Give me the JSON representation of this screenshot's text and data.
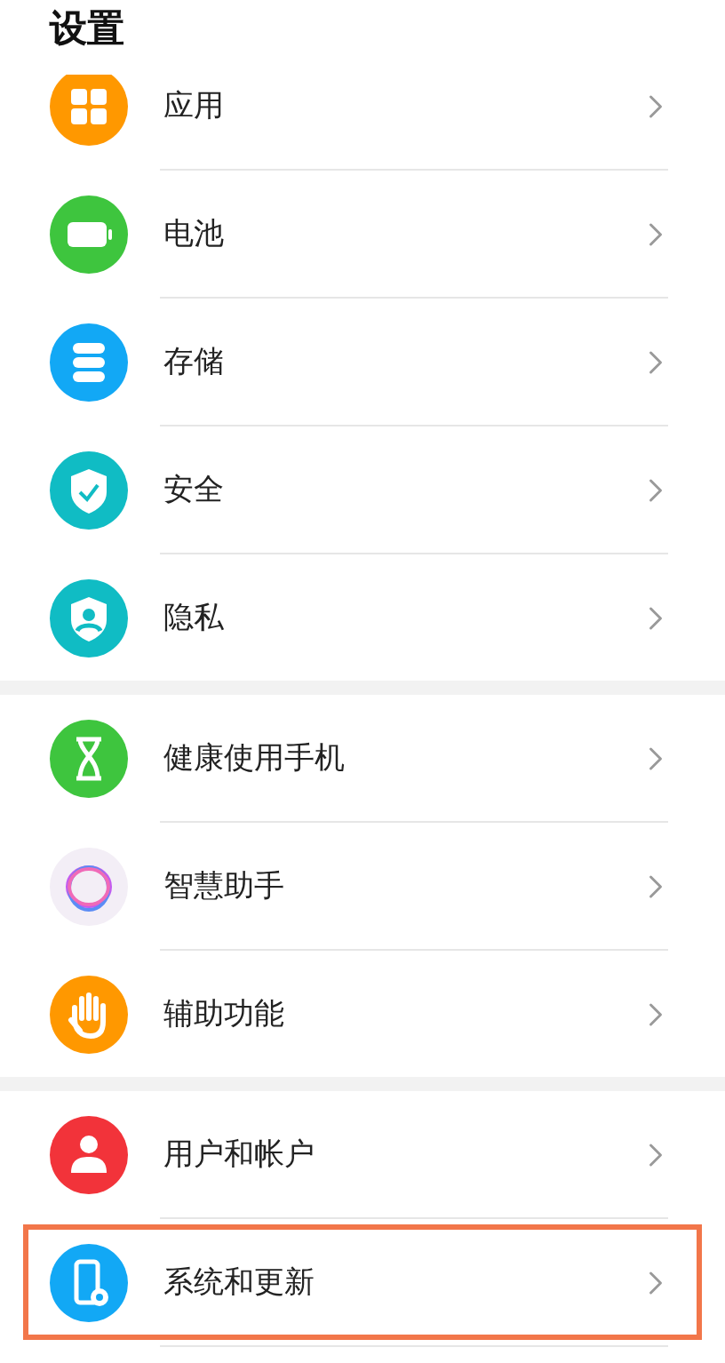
{
  "title": "设置",
  "sections": [
    {
      "items": [
        {
          "label": "应用",
          "kind": "apps",
          "color": "#ff9800",
          "highlighted": false
        },
        {
          "label": "电池",
          "kind": "battery",
          "color": "#3ec53e",
          "highlighted": false
        },
        {
          "label": "存储",
          "kind": "storage",
          "color": "#12a8f5",
          "highlighted": false
        },
        {
          "label": "安全",
          "kind": "shield",
          "color": "#10bcc4",
          "highlighted": false
        },
        {
          "label": "隐私",
          "kind": "privacy",
          "color": "#10bcc4",
          "highlighted": false
        }
      ]
    },
    {
      "items": [
        {
          "label": "健康使用手机",
          "kind": "hourglass",
          "color": "#3ec53e",
          "highlighted": false
        },
        {
          "label": "智慧助手",
          "kind": "ring",
          "color": "#f3eef6",
          "highlighted": false
        },
        {
          "label": "辅助功能",
          "kind": "hand",
          "color": "#ff9800",
          "highlighted": false
        }
      ]
    },
    {
      "items": [
        {
          "label": "用户和帐户",
          "kind": "user",
          "color": "#f2333a",
          "highlighted": false
        },
        {
          "label": "系统和更新",
          "kind": "phone-gear",
          "color": "#12a8f5",
          "highlighted": true
        }
      ]
    }
  ]
}
